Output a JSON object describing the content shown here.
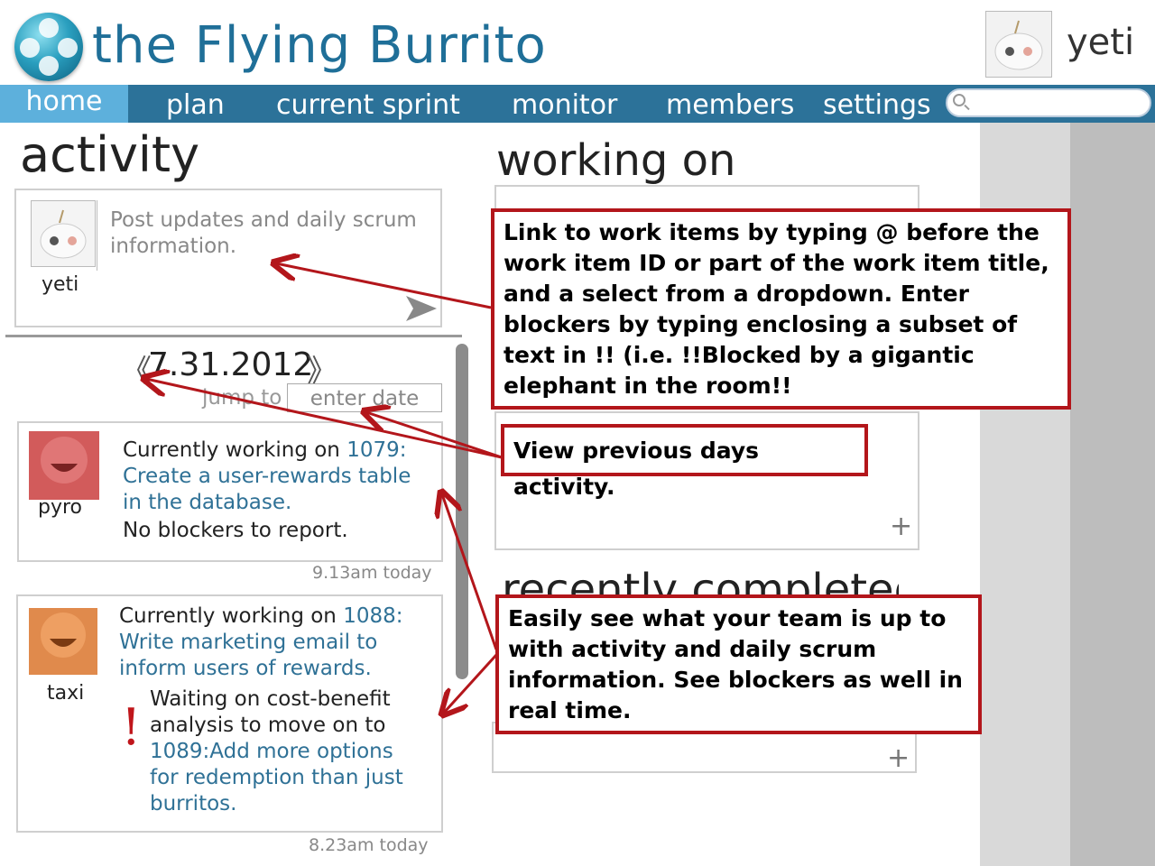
{
  "header": {
    "app_title": "the Flying Burrito",
    "user_name": "yeti"
  },
  "nav": {
    "items": [
      "home",
      "plan",
      "current sprint",
      "monitor",
      "members",
      "settings"
    ],
    "active": "home"
  },
  "search": {
    "placeholder": ""
  },
  "activity": {
    "heading": "activity",
    "post_box": {
      "placeholder": "Post updates and daily scrum information.",
      "author": "yeti"
    },
    "date_nav": {
      "prev": "《",
      "date": "7.31.2012",
      "next": "》",
      "jump_label": "jump to",
      "date_placeholder": "enter date"
    },
    "entries": [
      {
        "user": "pyro",
        "avatar_color": "#d25b5b",
        "prefix": "Currently working on ",
        "item_link": "1079: Create a user-rewards table in the database.",
        "status": "No blockers to report.",
        "timestamp": "9.13am today"
      },
      {
        "user": "taxi",
        "avatar_color": "#e08a4c",
        "prefix": "Currently working on ",
        "item_link": "1088: Write marketing email to inform users of rewards.",
        "blocker_mark": "!",
        "blocker_text": "Waiting on cost-benefit analysis to move on to ",
        "blocker_link": "1089:Add more options for redemption than just burritos.",
        "timestamp": "8.23am today"
      }
    ]
  },
  "working_on": {
    "heading": "working on",
    "add_label": "+",
    "add_label_2": "+",
    "partial_heading": "recently completed"
  },
  "annotations": {
    "link_items": "Link to work items by typing @ before the work item ID or part of the work item title, and a select from a dropdown. Enter blockers by typing enclosing a subset of text in !! (i.e. !!Blocked by a gigantic elephant in the room!!",
    "previous_days": "View previous days activity.",
    "team_activity": "Easily see what your team is up to with activity and daily scrum information. See blockers as well in real time."
  },
  "colors": {
    "nav_bg": "#2c7299",
    "nav_active": "#5db0dc",
    "title": "#1f6f98",
    "link": "#2f7196",
    "callout_border": "#b3161b",
    "blocker": "#c0161b"
  }
}
